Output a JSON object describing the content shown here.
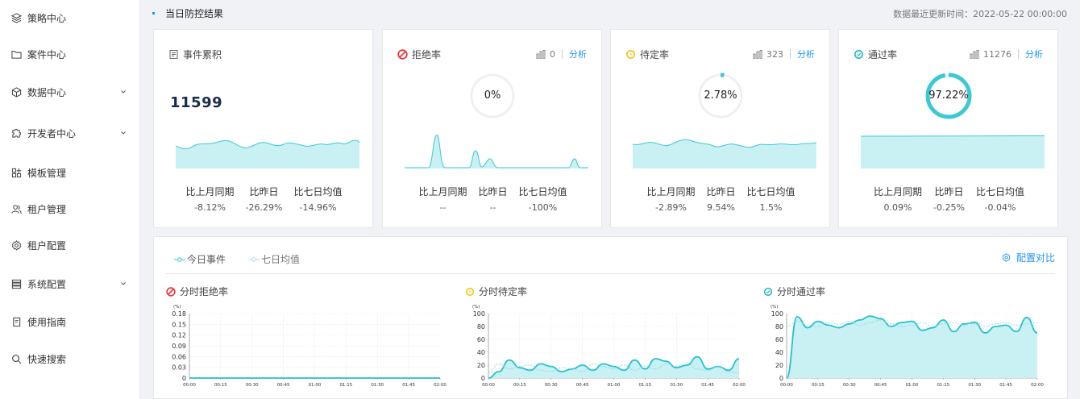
{
  "sidebar": {
    "items": [
      {
        "label": "策略中心",
        "icon": "layers-icon",
        "expandable": false
      },
      {
        "label": "案件中心",
        "icon": "folder-icon",
        "expandable": false
      },
      {
        "label": "数据中心",
        "icon": "cube-icon",
        "expandable": true
      },
      {
        "label": "开发者中心",
        "icon": "puzzle-icon",
        "expandable": true
      },
      {
        "label": "模板管理",
        "icon": "template-icon",
        "expandable": false
      },
      {
        "label": "租户管理",
        "icon": "users-icon",
        "expandable": false
      },
      {
        "label": "租户配置",
        "icon": "gear-icon",
        "expandable": false
      },
      {
        "label": "系统配置",
        "icon": "server-icon",
        "expandable": true
      },
      {
        "label": "使用指南",
        "icon": "book-icon",
        "expandable": false
      },
      {
        "label": "快速搜索",
        "icon": "search-icon",
        "expandable": false
      }
    ]
  },
  "header": {
    "title": "当日防控结果",
    "update_time": "数据最近更新时间：2022-05-22 00:00:00"
  },
  "cards": [
    {
      "title": "事件累积",
      "icon": "document-icon",
      "value": "11599",
      "stats": [
        {
          "label": "比上月同期",
          "value": "-8.12%"
        },
        {
          "label": "比昨日",
          "value": "-26.29%"
        },
        {
          "label": "比七日均值",
          "value": "-14.96%"
        }
      ]
    },
    {
      "title": "拒绝率",
      "icon": "forbidden-icon",
      "count": "0",
      "link": "分析",
      "percent": "0%",
      "ratio": 0,
      "stats": [
        {
          "label": "比上月同期",
          "value": "--"
        },
        {
          "label": "比昨日",
          "value": "--"
        },
        {
          "label": "比七日均值",
          "value": "-100%"
        }
      ]
    },
    {
      "title": "待定率",
      "icon": "clock-icon",
      "count": "323",
      "link": "分析",
      "percent": "2.78%",
      "ratio": 0.0278,
      "stats": [
        {
          "label": "比上月同期",
          "value": "-2.89%"
        },
        {
          "label": "比昨日",
          "value": "9.54%"
        },
        {
          "label": "比七日均值",
          "value": "1.5%"
        }
      ]
    },
    {
      "title": "通过率",
      "icon": "check-circle-icon",
      "count": "11276",
      "link": "分析",
      "percent": "97.22%",
      "ratio": 0.9722,
      "stats": [
        {
          "label": "比上月同期",
          "value": "0.09%"
        },
        {
          "label": "比昨日",
          "value": "-0.25%"
        },
        {
          "label": "比七日均值",
          "value": "-0.04%"
        }
      ]
    }
  ],
  "panel": {
    "legend": [
      "今日事件",
      "七日均值"
    ],
    "config_link": "配置对比",
    "charts": [
      {
        "title": "分时拒绝率",
        "icon": "forbidden-icon"
      },
      {
        "title": "分时待定率",
        "icon": "clock-icon"
      },
      {
        "title": "分时通过率",
        "icon": "check-circle-icon"
      }
    ]
  },
  "colors": {
    "accent": "#2196f3",
    "teal": "#3cc9d6",
    "teal_fill": "#c9f1f4",
    "reject": "#e8383d",
    "pending": "#f5c518",
    "pass": "#1fb5c2"
  },
  "chart_data": [
    {
      "type": "line",
      "title": "分时拒绝率",
      "ylabel": "(%)",
      "ylim": [
        0,
        0.18
      ],
      "yticks": [
        "0.18",
        "0.15",
        "0.12",
        "0.09",
        "0.06",
        "0.03",
        "0"
      ],
      "xticks": [
        "00:00",
        "00:15",
        "00:30",
        "00:45",
        "01:00",
        "01:15",
        "01:30",
        "01:45",
        "02:00"
      ],
      "series": [
        {
          "values": [
            0,
            0,
            0,
            0,
            0,
            0,
            0,
            0,
            0,
            0,
            0,
            0,
            0,
            0,
            0,
            0,
            0,
            0,
            0,
            0,
            0,
            0,
            0,
            0,
            0
          ]
        }
      ]
    },
    {
      "type": "area",
      "title": "分时待定率",
      "ylabel": "(%)",
      "ylim": [
        0,
        100
      ],
      "yticks": [
        "100",
        "80",
        "60",
        "40",
        "20",
        "0"
      ],
      "xticks": [
        "00:00",
        "00:15",
        "00:30",
        "00:45",
        "01:00",
        "01:15",
        "01:30",
        "01:45",
        "02:00"
      ],
      "series": [
        {
          "values": [
            0,
            10,
            28,
            16,
            12,
            22,
            18,
            10,
            14,
            20,
            12,
            22,
            18,
            12,
            28,
            14,
            30,
            26,
            16,
            20,
            33,
            14,
            18,
            12,
            30
          ]
        },
        {
          "values": [
            8,
            22,
            14,
            18,
            20,
            12,
            10,
            16,
            14,
            10,
            22,
            18,
            14,
            20,
            12,
            18,
            14,
            22,
            18,
            24,
            14,
            12,
            18,
            10,
            8
          ]
        }
      ]
    },
    {
      "type": "area",
      "title": "分时通过率",
      "ylabel": "(%)",
      "ylim": [
        0,
        100
      ],
      "yticks": [
        "100",
        "80",
        "60",
        "40",
        "20",
        "0"
      ],
      "xticks": [
        "00:00",
        "00:15",
        "00:30",
        "00:45",
        "01:00",
        "01:15",
        "01:30",
        "01:45",
        "02:00"
      ],
      "series": [
        {
          "values": [
            0,
            95,
            78,
            88,
            82,
            78,
            84,
            90,
            96,
            92,
            80,
            86,
            88,
            74,
            78,
            90,
            72,
            84,
            86,
            70,
            80,
            82,
            72,
            94,
            70
          ]
        },
        {
          "values": [
            80,
            88,
            82,
            80,
            86,
            84,
            88,
            82,
            86,
            90,
            84,
            80,
            82,
            86,
            80,
            84,
            86,
            82,
            88,
            80,
            84,
            86,
            82,
            84,
            86
          ]
        }
      ]
    }
  ]
}
